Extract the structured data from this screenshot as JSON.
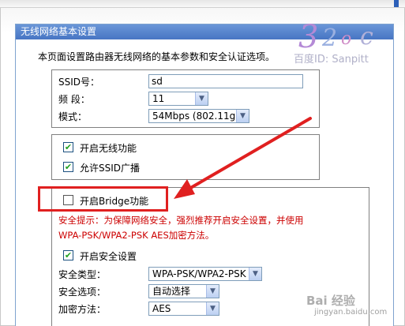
{
  "panel": {
    "title": "无线网络基本设置",
    "intro": "本页面设置路由器无线网络的基本参数和安全认证选项。"
  },
  "basic": {
    "ssid_label": "SSID号：",
    "ssid_value": "sd",
    "channel_label": "频  段：",
    "channel_value": "11",
    "mode_label": "模式：",
    "mode_value": "54Mbps (802.11g)"
  },
  "wireless": {
    "enable_label": "开启无线功能",
    "enable_checked": true,
    "ssid_broadcast_label": "允许SSID广播",
    "ssid_broadcast_checked": true
  },
  "bridge": {
    "label": "开启Bridge功能",
    "checked": false
  },
  "security": {
    "warning_line1": "安全提示：为保障网络安全，强烈推荐开启安全设置，并使用",
    "warning_line2": "WPA-PSK/WPA2-PSK AES加密方法。",
    "enable_label": "开启安全设置",
    "enable_checked": true,
    "type_label": "安全类型：",
    "type_value": "WPA-PSK/WPA2-PSK",
    "option_label": "安全选项：",
    "option_value": "自动选择",
    "encryption_label": "加密方法：",
    "encryption_value": "AES"
  },
  "watermark": {
    "top_text": "百度ID: Sanpitt",
    "bottom_text": "Bai 经验",
    "bottom_sub": "jingyan.baidu.com"
  },
  "colors": {
    "header_blue": "#4775c3",
    "warning_red": "#cc0000",
    "annotation_red": "#e02020"
  }
}
